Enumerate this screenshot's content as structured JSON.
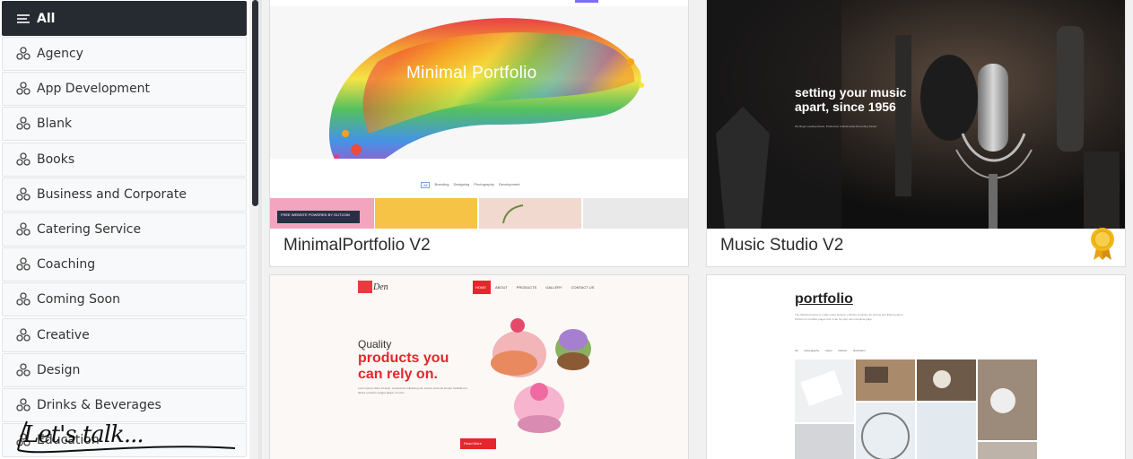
{
  "sidebar": {
    "items": [
      {
        "label": "All",
        "icon": "menu-icon",
        "active": true
      },
      {
        "label": "Agency",
        "icon": "category-icon"
      },
      {
        "label": "App Development",
        "icon": "category-icon"
      },
      {
        "label": "Blank",
        "icon": "category-icon"
      },
      {
        "label": "Books",
        "icon": "category-icon"
      },
      {
        "label": "Business and Corporate",
        "icon": "category-icon"
      },
      {
        "label": "Catering Service",
        "icon": "category-icon"
      },
      {
        "label": "Coaching",
        "icon": "category-icon"
      },
      {
        "label": "Coming Soon",
        "icon": "category-icon"
      },
      {
        "label": "Creative",
        "icon": "category-icon"
      },
      {
        "label": "Design",
        "icon": "category-icon"
      },
      {
        "label": "Drinks & Beverages",
        "icon": "category-icon"
      },
      {
        "label": "Education",
        "icon": "category-icon"
      }
    ],
    "chat_widget": {
      "label": "Let's talk..."
    }
  },
  "templates": [
    {
      "title": "MinimalPortfolio V2",
      "preview": {
        "hero_text": "Minimal Portfolio",
        "filters": [
          "All",
          "Branding",
          "Designing",
          "Photography",
          "Development"
        ],
        "overlay_banner": "FREE WEBSITE POWERED BY GUTCOM"
      }
    },
    {
      "title": "Music Studio V2",
      "badge": "award-badge-icon",
      "preview": {
        "headline_line1": "setting your music",
        "headline_line2": "apart, since 1956",
        "subline": "We Begin Leading Music, Production & Multimedia Recording Studio"
      }
    },
    {
      "title": "",
      "preview": {
        "logo_text": "Den",
        "nav": [
          "HOME",
          "ABOUT",
          "PRODUCTS",
          "GALLERY",
          "CONTACT US"
        ],
        "kicker": "Quality",
        "headline_line1": "products you",
        "headline_line2": "can rely on.",
        "body": "Lorem ipsum dolor sit amet, consectetur adipiscing elit, sed do eiusmod tempor incididunt ut labore et dolore magna aliqua. Ut enim",
        "cta": "Read More"
      }
    },
    {
      "title": "",
      "preview": {
        "heading": "portfolio",
        "body": "The following layout is made using Isotope, a library of jQuery for sorting and filtering items. Perfect for portfolio pages and it can be your own complete page",
        "filters": [
          "All",
          "photography",
          "travel",
          "fashion",
          "illustration"
        ]
      }
    }
  ],
  "colors": {
    "sidebar_active": "#262b31",
    "accent_red": "#e6262c",
    "badge_gold": "#f3b71c"
  }
}
